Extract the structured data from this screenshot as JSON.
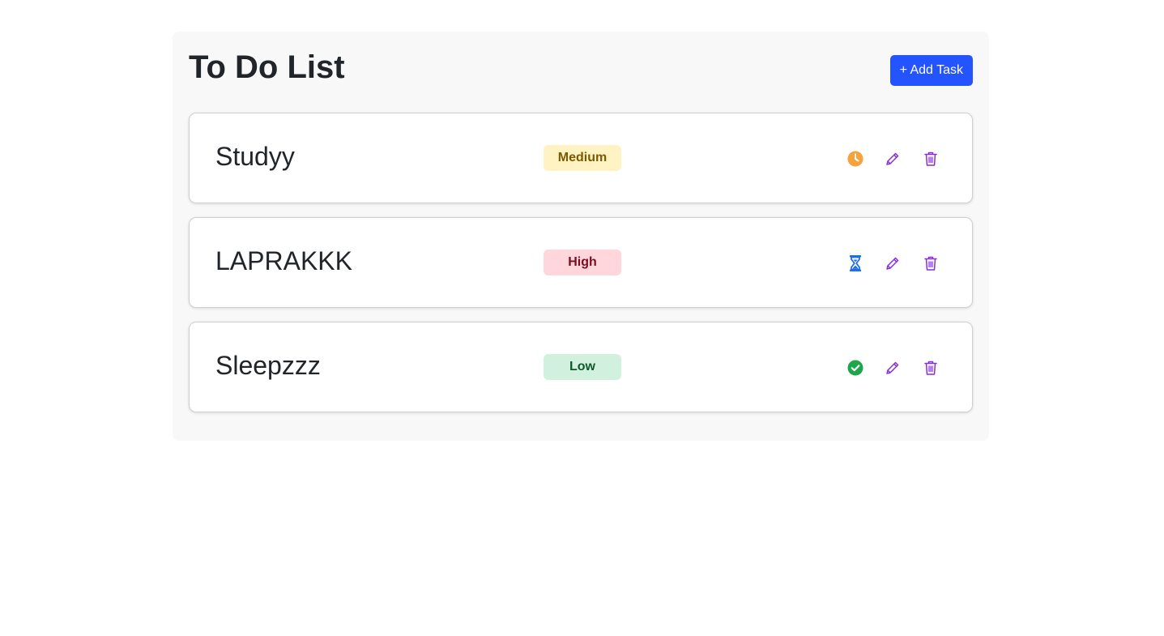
{
  "header": {
    "title": "To Do List",
    "add_task_label": "+ Add Task"
  },
  "colors": {
    "accent": "#2454ff",
    "action_purple": "#8a2be2"
  },
  "tasks": [
    {
      "title": "Studyy",
      "priority": "Medium",
      "priority_bg": "#fff3c4",
      "priority_fg": "#7a5a00",
      "status_icon": "clock-icon",
      "status_color": "#f5a33a"
    },
    {
      "title": "LAPRAKKK",
      "priority": "High",
      "priority_bg": "#ffd6dc",
      "priority_fg": "#7a0d1c",
      "status_icon": "hourglass-icon",
      "status_color": "#1e6ff0"
    },
    {
      "title": "Sleepzzz",
      "priority": "Low",
      "priority_bg": "#d2f0de",
      "priority_fg": "#0e5a2c",
      "status_icon": "check-circle-icon",
      "status_color": "#1fa64a"
    }
  ]
}
